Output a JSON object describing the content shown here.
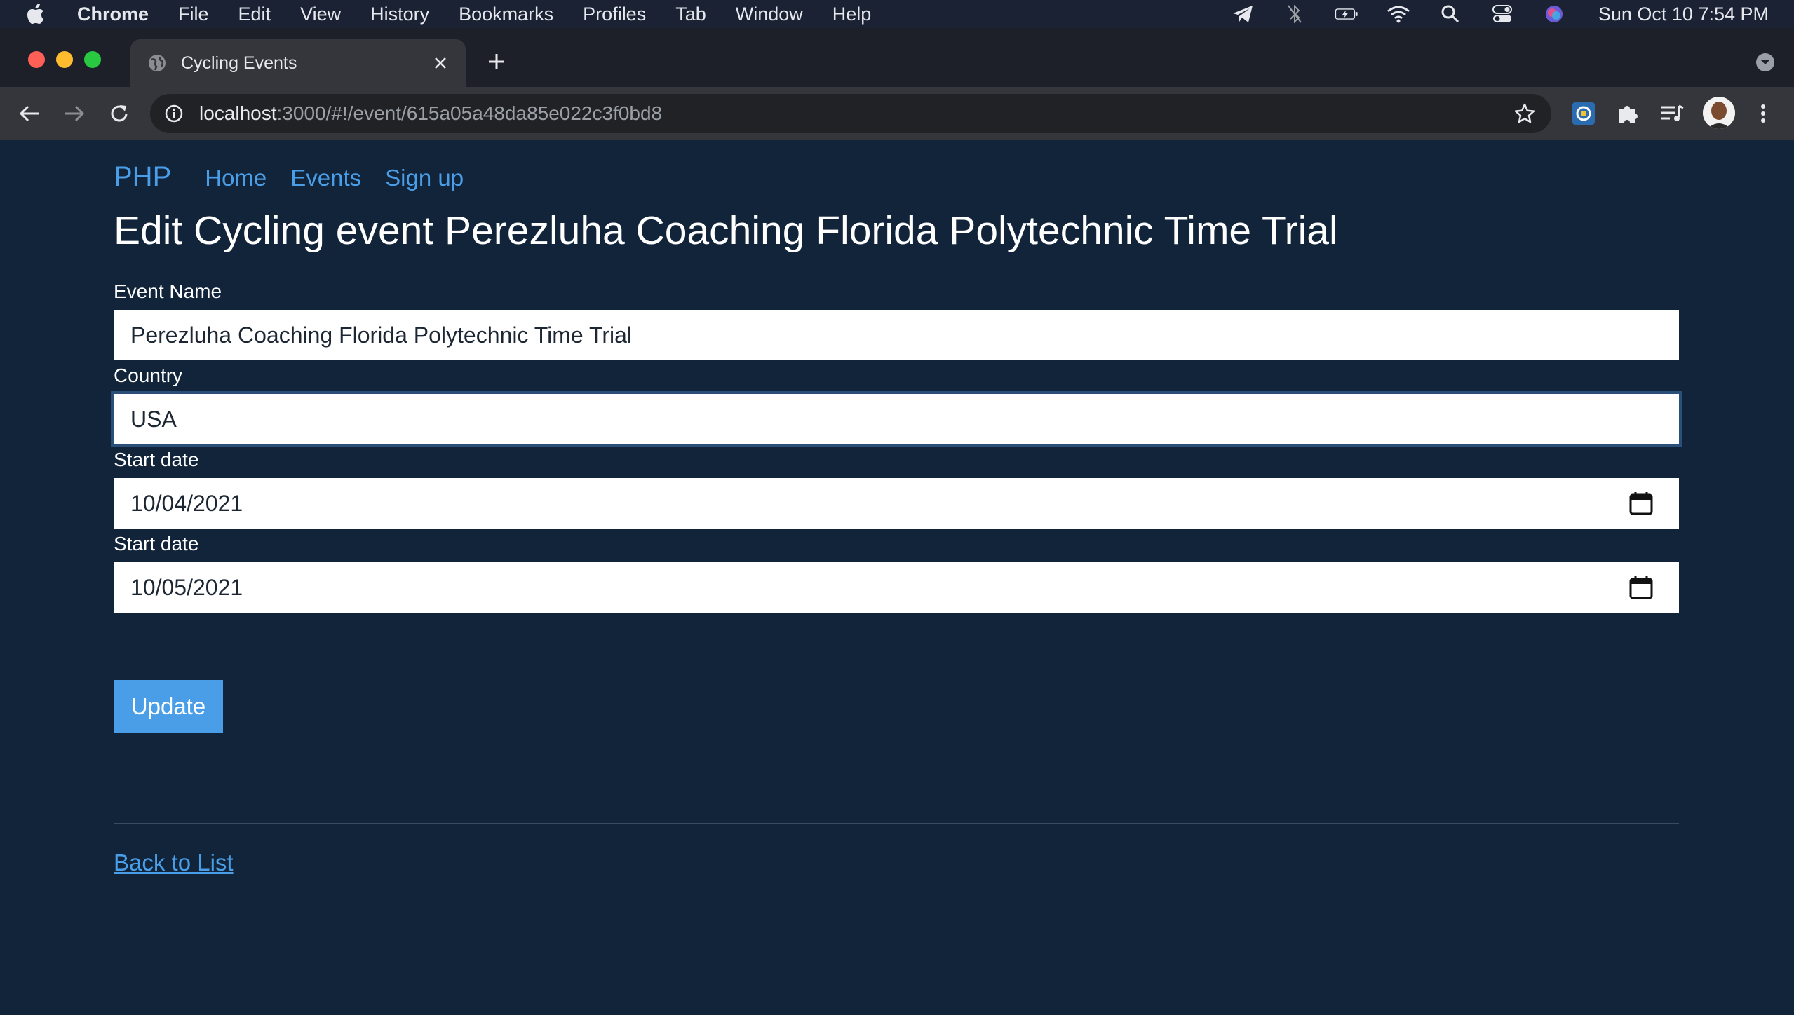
{
  "menubar": {
    "items": [
      "Chrome",
      "File",
      "Edit",
      "View",
      "History",
      "Bookmarks",
      "Profiles",
      "Tab",
      "Window",
      "Help"
    ],
    "clock": "Sun Oct 10  7:54 PM"
  },
  "browser": {
    "tab_title": "Cycling Events",
    "url_host": "localhost",
    "url_rest": ":3000/#!/event/615a05a48da85e022c3f0bd8"
  },
  "page": {
    "navbar": {
      "brand": "PHP",
      "links": [
        "Home",
        "Events",
        "Sign up"
      ]
    },
    "heading": "Edit Cycling event Perezluha Coaching Florida Polytechnic Time Trial",
    "form": {
      "event_name": {
        "label": "Event Name",
        "value": "Perezluha Coaching Florida Polytechnic Time Trial"
      },
      "country": {
        "label": "Country",
        "value": "USA"
      },
      "start_date": {
        "label": "Start date",
        "value": "10/04/2021"
      },
      "end_date": {
        "label": "Start date",
        "value": "10/05/2021"
      },
      "submit_label": "Update"
    },
    "back_link": "Back to List"
  },
  "colors": {
    "page_background": "#11243a",
    "link": "#4a9ee8",
    "button": "#4a9ee8"
  }
}
